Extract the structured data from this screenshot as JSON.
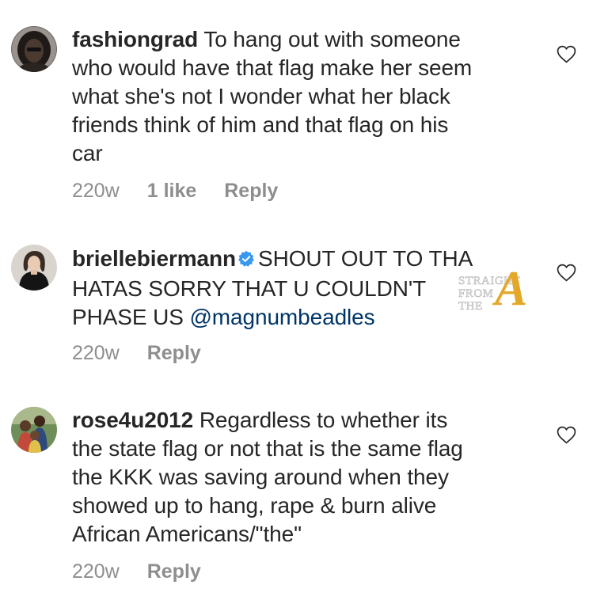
{
  "comments": [
    {
      "username": "fashiongrad",
      "text_lines": [
        "To hang out with someone",
        "who would have that flag make her seem",
        "what she's not I wonder what her black",
        "friends think of him and that flag on his",
        "car"
      ],
      "time": "220w",
      "likes": "1 like",
      "reply_label": "Reply",
      "avatar_icon": "dark-avatar-icon"
    },
    {
      "username": "briellebiermann",
      "verified_icon": "verified-badge-icon",
      "text_first": "SHOUT OUT TO THA",
      "text_lines": [
        "HATAS SORRY THAT U COULDN'T"
      ],
      "text_last": "PHASE US ",
      "mention": "@magnumbeadles",
      "time": "220w",
      "reply_label": "Reply",
      "avatar_icon": "profile-photo-avatar-icon"
    },
    {
      "username": "rose4u2012",
      "text_lines": [
        "Regardless to whether its",
        "the state flag or not that is the same flag",
        "the KKK was saving around when they",
        "showed up to hang, rape & burn alive",
        "African Americans/\"the\""
      ],
      "time": "220w",
      "reply_label": "Reply",
      "avatar_icon": "group-photo-avatar-icon"
    }
  ],
  "watermark": {
    "line1": "STRAIGHT",
    "line2": "FROM",
    "line3": "THE",
    "letter": "A"
  },
  "colors": {
    "text": "#262626",
    "meta": "#8e8e8e",
    "mention": "#003569",
    "verified": "#3897f0",
    "watermark_gold": "#e3a72a"
  }
}
